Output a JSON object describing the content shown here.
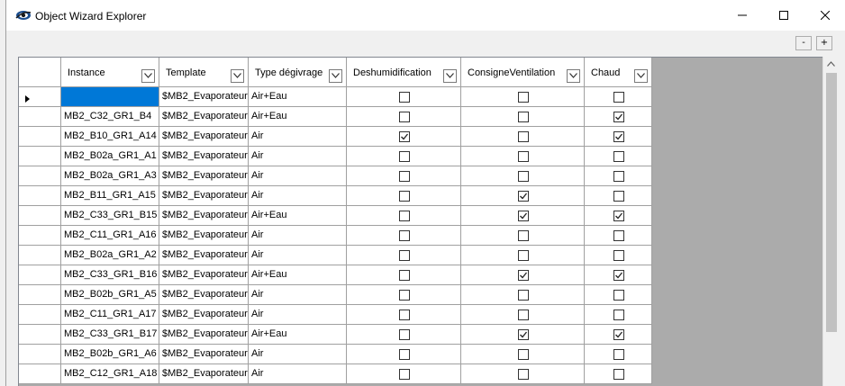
{
  "window": {
    "title": "Object Wizard Explorer"
  },
  "toolbar": {
    "collapse_label": "-",
    "expand_label": "+"
  },
  "grid": {
    "columns": [
      {
        "key": "instance",
        "label": "Instance"
      },
      {
        "key": "template",
        "label": "Template"
      },
      {
        "key": "type",
        "label": "Type  dégivrage"
      },
      {
        "key": "deshum",
        "label": "Deshumidification"
      },
      {
        "key": "consigne",
        "label": "ConsigneVentilation"
      },
      {
        "key": "chaud",
        "label": "Chaud"
      }
    ],
    "rows": [
      {
        "instance": "",
        "template": "$MB2_Evaporateur",
        "type": "Air+Eau",
        "deshum": false,
        "consigne": false,
        "chaud": false,
        "current": true
      },
      {
        "instance": "MB2_C32_GR1_B4",
        "template": "$MB2_Evaporateur",
        "type": "Air+Eau",
        "deshum": false,
        "consigne": false,
        "chaud": true
      },
      {
        "instance": "MB2_B10_GR1_A14",
        "template": "$MB2_Evaporateur",
        "type": "Air",
        "deshum": true,
        "consigne": false,
        "chaud": true
      },
      {
        "instance": "MB2_B02a_GR1_A1",
        "template": "$MB2_Evaporateur",
        "type": "Air",
        "deshum": false,
        "consigne": false,
        "chaud": false
      },
      {
        "instance": "MB2_B02a_GR1_A3",
        "template": "$MB2_Evaporateur",
        "type": "Air",
        "deshum": false,
        "consigne": false,
        "chaud": false
      },
      {
        "instance": "MB2_B11_GR1_A15",
        "template": "$MB2_Evaporateur",
        "type": "Air",
        "deshum": false,
        "consigne": true,
        "chaud": false
      },
      {
        "instance": "MB2_C33_GR1_B15",
        "template": "$MB2_Evaporateur",
        "type": "Air+Eau",
        "deshum": false,
        "consigne": true,
        "chaud": true
      },
      {
        "instance": "MB2_C11_GR1_A16",
        "template": "$MB2_Evaporateur",
        "type": "Air",
        "deshum": false,
        "consigne": false,
        "chaud": false
      },
      {
        "instance": "MB2_B02a_GR1_A2",
        "template": "$MB2_Evaporateur",
        "type": "Air",
        "deshum": false,
        "consigne": false,
        "chaud": false
      },
      {
        "instance": "MB2_C33_GR1_B16",
        "template": "$MB2_Evaporateur",
        "type": "Air+Eau",
        "deshum": false,
        "consigne": true,
        "chaud": true
      },
      {
        "instance": "MB2_B02b_GR1_A5",
        "template": "$MB2_Evaporateur",
        "type": "Air",
        "deshum": false,
        "consigne": false,
        "chaud": false
      },
      {
        "instance": "MB2_C11_GR1_A17",
        "template": "$MB2_Evaporateur",
        "type": "Air",
        "deshum": false,
        "consigne": false,
        "chaud": false
      },
      {
        "instance": "MB2_C33_GR1_B17",
        "template": "$MB2_Evaporateur",
        "type": "Air+Eau",
        "deshum": false,
        "consigne": true,
        "chaud": true
      },
      {
        "instance": "MB2_B02b_GR1_A6",
        "template": "$MB2_Evaporateur",
        "type": "Air",
        "deshum": false,
        "consigne": false,
        "chaud": false
      },
      {
        "instance": "MB2_C12_GR1_A18",
        "template": "$MB2_Evaporateur",
        "type": "Air",
        "deshum": false,
        "consigne": false,
        "chaud": false
      }
    ]
  },
  "icons": {
    "app": "eye-icon",
    "minimize": "minimize-icon",
    "maximize": "maximize-icon",
    "close": "close-icon",
    "dropdown": "chevron-down-icon",
    "row_pointer": "row-pointer-icon",
    "check": "check-icon"
  }
}
